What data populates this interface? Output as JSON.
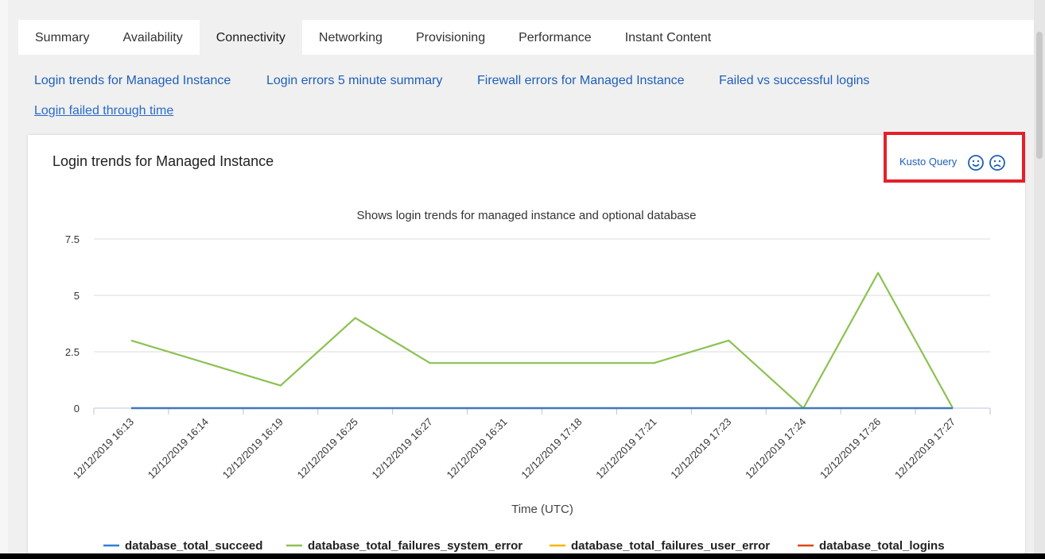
{
  "tabs": [
    {
      "label": "Summary",
      "active": false
    },
    {
      "label": "Availability",
      "active": false
    },
    {
      "label": "Connectivity",
      "active": true
    },
    {
      "label": "Networking",
      "active": false
    },
    {
      "label": "Provisioning",
      "active": false
    },
    {
      "label": "Performance",
      "active": false
    },
    {
      "label": "Instant Content",
      "active": false
    }
  ],
  "sublinks": [
    {
      "label": "Login trends for Managed Instance",
      "active": false
    },
    {
      "label": "Login errors 5 minute summary",
      "active": false
    },
    {
      "label": "Firewall errors for Managed Instance",
      "active": false
    },
    {
      "label": "Failed vs successful logins",
      "active": false
    },
    {
      "label": "Login failed through time",
      "active": true
    }
  ],
  "card": {
    "title": "Login trends for Managed Instance",
    "kusto_label": "Kusto Query",
    "icons": [
      "smile-icon",
      "frown-icon"
    ],
    "highlight_color": "#e3202a"
  },
  "chart_data": {
    "type": "line",
    "title": "Shows login trends for managed instance and optional database",
    "xlabel": "Time (UTC)",
    "ylabel": "",
    "ylim": [
      0,
      7.5
    ],
    "yticks": [
      "0",
      "2.5",
      "5",
      "7.5"
    ],
    "grid": true,
    "legend_position": "bottom",
    "categories": [
      "12/12/2019 16:13",
      "12/12/2019 16:14",
      "12/12/2019 16:19",
      "12/12/2019 16:25",
      "12/12/2019 16:27",
      "12/12/2019 16:31",
      "12/12/2019 17:18",
      "12/12/2019 17:21",
      "12/12/2019 17:23",
      "12/12/2019 17:24",
      "12/12/2019 17:26",
      "12/12/2019 17:27"
    ],
    "series": [
      {
        "name": "database_total_succeed",
        "color": "#2f7ed8",
        "values": [
          0,
          0,
          0,
          0,
          0,
          0,
          0,
          0,
          0,
          0,
          0,
          0
        ]
      },
      {
        "name": "database_total_failures_system_error",
        "color": "#8cc152",
        "values": [
          3,
          2,
          1,
          4,
          2,
          2,
          2,
          2,
          3,
          0,
          6,
          0
        ]
      },
      {
        "name": "database_total_failures_user_error",
        "color": "#f8b500",
        "values": [
          0,
          0,
          0,
          0,
          0,
          0,
          0,
          0,
          0,
          0,
          0,
          0
        ]
      },
      {
        "name": "database_total_logins",
        "color": "#d9480f",
        "values": [
          0,
          0,
          0,
          0,
          0,
          0,
          0,
          0,
          0,
          0,
          0,
          0
        ]
      }
    ]
  }
}
